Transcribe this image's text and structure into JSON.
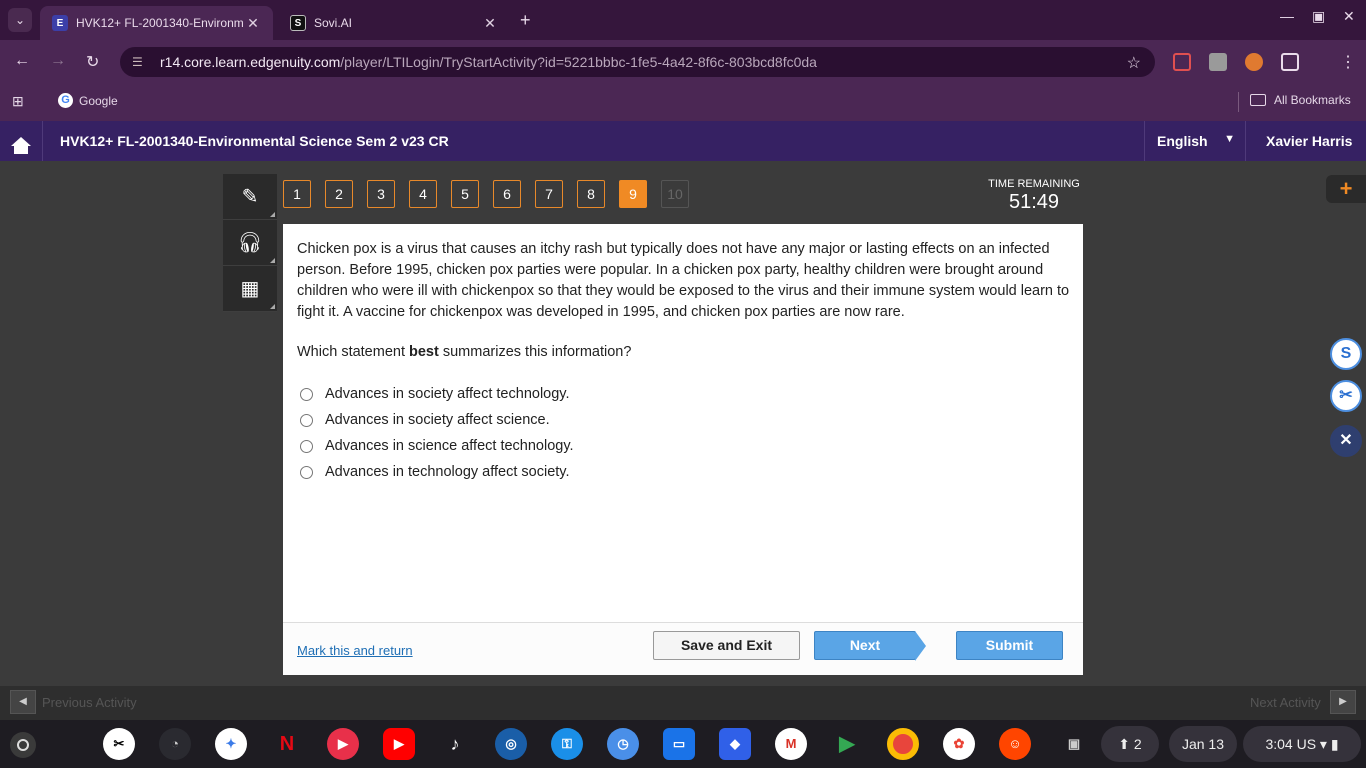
{
  "browser": {
    "tabs": [
      {
        "title": "HVK12+ FL-2001340-Environm",
        "favicon": "E",
        "active": true
      },
      {
        "title": "Sovi.AI",
        "favicon": "S",
        "active": false
      }
    ],
    "url_host": "r14.core.learn.edgenuity.com",
    "url_path": "/player/LTILogin/TryStartActivity?id=5221bbbc-1fe5-4a42-8f6c-803bcd8fc0da",
    "bookmarks": {
      "google": "Google",
      "all": "All Bookmarks"
    }
  },
  "app": {
    "course_title": "HVK12+ FL-2001340-Environmental Science Sem 2 v23 CR",
    "language": "English",
    "user": "Xavier Harris"
  },
  "quiz": {
    "question_numbers": [
      "1",
      "2",
      "3",
      "4",
      "5",
      "6",
      "7",
      "8",
      "9",
      "10"
    ],
    "current_question": "9",
    "timer_label": "TIME REMAINING",
    "timer_value": "51:49",
    "passage": "Chicken pox is a virus that causes an itchy rash but typically does not have any major or lasting effects on an infected person. Before 1995, chicken pox parties were popular. In a chicken pox party, healthy children were brought around children who were ill with chickenpox so that they would be exposed to the virus and their immune system would learn to fight it. A vaccine for chickenpox was developed in 1995, and chicken pox parties are now rare.",
    "question_pre": "Which statement ",
    "question_bold": "best",
    "question_post": " summarizes this information?",
    "options": [
      "Advances in society affect technology.",
      "Advances in society affect science.",
      "Advances in science affect technology.",
      "Advances in technology affect society."
    ],
    "mark_return": "Mark this and return",
    "save_exit": "Save and Exit",
    "next": "Next",
    "submit": "Submit"
  },
  "activity_bar": {
    "previous": "Previous Activity",
    "next": "Next Activity"
  },
  "taskbar": {
    "date": "Jan 13",
    "time": "3:04",
    "locale": "US",
    "notifications": "2"
  },
  "colors": {
    "accent_orange": "#f08a24",
    "header_purple": "#362163",
    "button_blue": "#5aa5e6"
  }
}
